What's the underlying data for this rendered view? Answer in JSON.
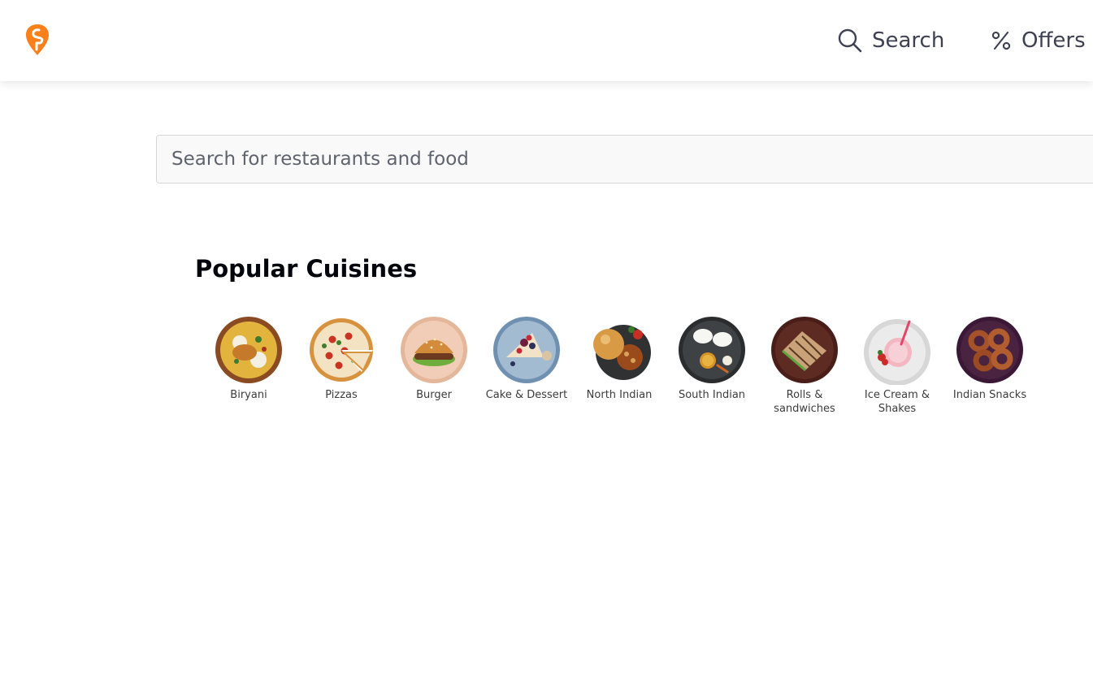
{
  "header": {
    "nav": [
      {
        "label": "Search",
        "icon": "search-icon"
      },
      {
        "label": "Offers",
        "icon": "percent-icon"
      }
    ],
    "colors": {
      "brand": "#fc8019",
      "nav_text": "#3d4152"
    }
  },
  "search": {
    "placeholder": "Search for restaurants and food",
    "value": ""
  },
  "section": {
    "title": "Popular Cuisines"
  },
  "cuisines": [
    {
      "label": "Biryani",
      "icon": "biryani-icon"
    },
    {
      "label": "Pizzas",
      "icon": "pizza-icon"
    },
    {
      "label": "Burger",
      "icon": "burger-icon"
    },
    {
      "label": "Cake & Dessert",
      "icon": "cake-icon"
    },
    {
      "label": "North Indian",
      "icon": "north-indian-icon"
    },
    {
      "label": "South Indian",
      "icon": "south-indian-icon"
    },
    {
      "label": "Rolls & sandwiches",
      "icon": "sandwich-icon"
    },
    {
      "label": "Ice Cream & Shakes",
      "icon": "ice-cream-icon"
    },
    {
      "label": "Indian Snacks",
      "icon": "indian-snacks-icon"
    }
  ]
}
